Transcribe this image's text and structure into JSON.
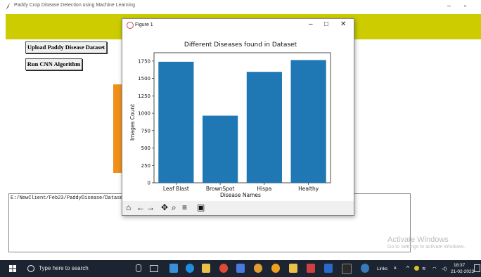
{
  "main_window": {
    "title": "Paddy Crop Disease Detection using Machine Learning",
    "minimize_symbol": "–",
    "maximize_symbol": "▫"
  },
  "buttons": {
    "upload_label": "Upload Paddy Disease Dataset",
    "cnn_label": "Run CNN Algorithm"
  },
  "output": {
    "path_text": "E:/NewClient/Feb23/PaddyDisease/Dataset"
  },
  "figure": {
    "window_title": "Figure 1",
    "minimize_symbol": "–",
    "maximize_symbol": "□",
    "close_symbol": "✕",
    "toolbar_icons": [
      "home-icon",
      "back-arrow-icon",
      "forward-arrow-icon",
      "pan-icon",
      "zoom-icon",
      "configure-subplots-icon",
      "save-icon"
    ]
  },
  "chart_data": {
    "type": "bar",
    "title": "Different Diseases found in Dataset",
    "xlabel": "Disease Names",
    "ylabel": "Images Count",
    "categories": [
      "Leaf Blast",
      "BrownSpot",
      "Hispa",
      "Healthy"
    ],
    "values": [
      1740,
      965,
      1595,
      1765
    ],
    "ylim": [
      0,
      1870
    ],
    "yticks": [
      "0",
      "250",
      "500",
      "750",
      "1000",
      "1250",
      "1500",
      "1750"
    ],
    "bar_color": "#1f77b4",
    "grid": false
  },
  "watermark": {
    "line1": "Activate Windows",
    "line2": "Go to Settings to activate Windows."
  },
  "taskbar": {
    "search_placeholder": "Type here to search",
    "links_label": "Links",
    "time": "18:37",
    "date": "21-02-2023"
  },
  "colors": {
    "header_band": "#cccc00",
    "orange_block": "#f0901a",
    "taskbar_bg": "#1c2431"
  }
}
